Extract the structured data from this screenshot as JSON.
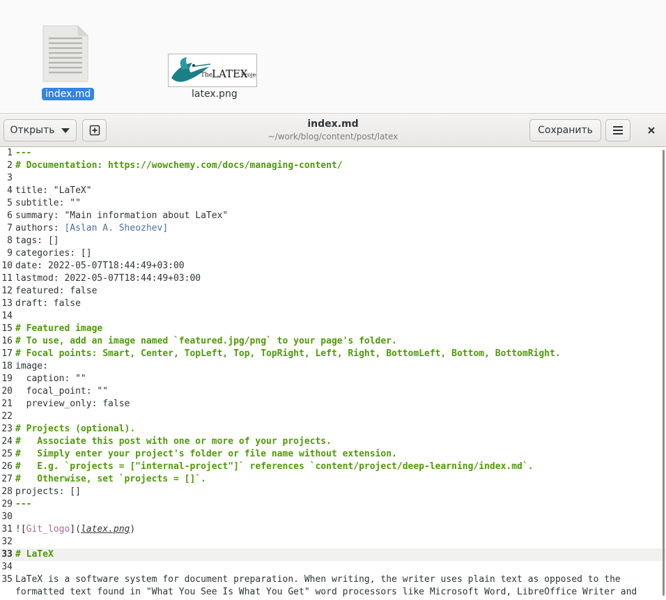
{
  "desktop": {
    "files": [
      {
        "name": "index.md",
        "selected": true,
        "icon": "text-document-icon"
      },
      {
        "name": "latex.png",
        "selected": false,
        "icon": "image-thumbnail"
      }
    ],
    "thumbnail_text": {
      "the": "The",
      "latex": "LATEX",
      "project": "Project"
    }
  },
  "window": {
    "title": "index.md",
    "subtitle": "~/work/blog/content/post/latex",
    "open_label": "Открыть",
    "save_label": "Сохранить",
    "new_tab_icon": "new-tab-icon",
    "menu_icon": "hamburger-menu-icon",
    "close_icon": "close-icon"
  },
  "editor": {
    "current_line": 33,
    "lines": [
      {
        "n": "1",
        "text": "---",
        "style": "heading"
      },
      {
        "n": "2",
        "text": "# Documentation: https://wowchemy.com/docs/managing-content/",
        "style": "heading"
      },
      {
        "n": "3",
        "text": "",
        "style": "plain"
      },
      {
        "n": "4",
        "text": "title: \"LaTeX\"",
        "style": "plain"
      },
      {
        "n": "5",
        "text": "subtitle: \"\"",
        "style": "plain"
      },
      {
        "n": "6",
        "text": "summary: \"Main information about LaTex\"",
        "style": "plain"
      },
      {
        "n": "7",
        "text": "authors: ",
        "style": "plain",
        "link": "[Aslan A. Sheozhev]"
      },
      {
        "n": "8",
        "text": "tags: []",
        "style": "plain"
      },
      {
        "n": "9",
        "text": "categories: []",
        "style": "plain"
      },
      {
        "n": "10",
        "text": "date: 2022-05-07T18:44:49+03:00",
        "style": "plain"
      },
      {
        "n": "11",
        "text": "lastmod: 2022-05-07T18:44:49+03:00",
        "style": "plain"
      },
      {
        "n": "12",
        "text": "featured: false",
        "style": "plain"
      },
      {
        "n": "13",
        "text": "draft: false",
        "style": "plain"
      },
      {
        "n": "14",
        "text": "",
        "style": "plain"
      },
      {
        "n": "15",
        "text": "# Featured image",
        "style": "heading"
      },
      {
        "n": "16",
        "text": "# To use, add an image named `featured.jpg/png` to your page's folder.",
        "style": "heading"
      },
      {
        "n": "17",
        "text": "# Focal points: Smart, Center, TopLeft, Top, TopRight, Left, Right, BottomLeft, Bottom, BottomRight.",
        "style": "heading"
      },
      {
        "n": "18",
        "text": "image:",
        "style": "plain"
      },
      {
        "n": "19",
        "text": "  caption: \"\"",
        "style": "plain"
      },
      {
        "n": "20",
        "text": "  focal_point: \"\"",
        "style": "plain"
      },
      {
        "n": "21",
        "text": "  preview_only: false",
        "style": "plain"
      },
      {
        "n": "22",
        "text": "",
        "style": "plain"
      },
      {
        "n": "23",
        "text": "# Projects (optional).",
        "style": "heading"
      },
      {
        "n": "24",
        "text": "#   Associate this post with one or more of your projects.",
        "style": "heading"
      },
      {
        "n": "25",
        "text": "#   Simply enter your project's folder or file name without extension.",
        "style": "heading"
      },
      {
        "n": "26",
        "text": "#   E.g. `projects = [\"internal-project\"]` references `content/project/deep-learning/index.md`.",
        "style": "heading"
      },
      {
        "n": "27",
        "text": "#   Otherwise, set `projects = []`.",
        "style": "heading"
      },
      {
        "n": "28",
        "text": "projects: []",
        "style": "plain"
      },
      {
        "n": "29",
        "text": "---",
        "style": "heading"
      },
      {
        "n": "30",
        "text": "",
        "style": "plain"
      },
      {
        "n": "31",
        "text": "",
        "style": "image",
        "img_open": "![",
        "img_alt": "Git_logo",
        "img_mid": "](",
        "img_url": "latex.png",
        "img_close": ")"
      },
      {
        "n": "32",
        "text": "",
        "style": "plain"
      },
      {
        "n": "33",
        "text": "# LaTeX",
        "style": "heading"
      },
      {
        "n": "34",
        "text": "",
        "style": "plain"
      },
      {
        "n": "35",
        "text": "LaTeX is a software system for document preparation. When writing, the writer uses plain text as opposed to the",
        "style": "plain"
      },
      {
        "n": "",
        "text": "formatted text found in \"What You See Is What You Get\" word processors like Microsoft Word, LibreOffice Writer and",
        "style": "plain"
      }
    ]
  }
}
